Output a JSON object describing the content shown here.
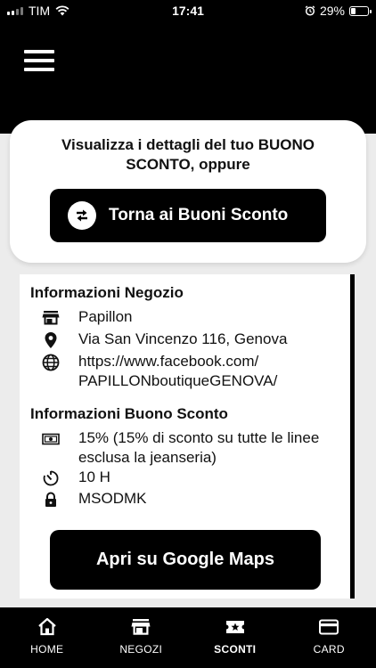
{
  "status_bar": {
    "carrier": "TIM",
    "time": "17:41",
    "battery": "29%",
    "battery_level": 0.29
  },
  "top_card": {
    "intro_text": "Visualizza i dettagli del tuo BUONO SCONTO, oppure",
    "back_button_label": "Torna ai Buoni Sconto"
  },
  "store_info": {
    "title": "Informazioni Negozio",
    "name": "Papillon",
    "address": "Via San Vincenzo 116, Genova",
    "website_line1": "https://www.facebook.com/",
    "website_line2": "PAPILLONboutiqueGENOVA/"
  },
  "voucher_info": {
    "title": "Informazioni Buono Sconto",
    "discount_line1": "15% (15% di sconto su tutte le linee",
    "discount_line2": "esclusa la jeanseria)",
    "duration": "10 H",
    "code": "MSODMK"
  },
  "maps_button_label": "Apri su Google Maps",
  "tabs": [
    {
      "label": "HOME",
      "icon": "home-icon"
    },
    {
      "label": "NEGOZI",
      "icon": "store-icon"
    },
    {
      "label": "SCONTI",
      "icon": "ticket-star-icon",
      "active": true
    },
    {
      "label": "CARD",
      "icon": "credit-card-icon"
    }
  ],
  "colors": {
    "primary": "#000000",
    "background": "#ececec",
    "card": "#ffffff"
  }
}
